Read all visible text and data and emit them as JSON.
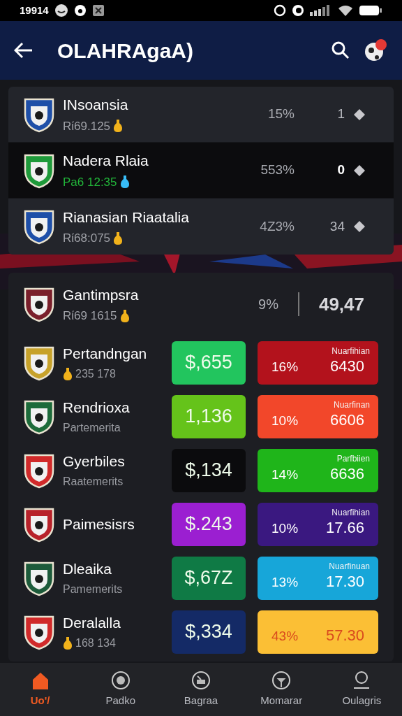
{
  "status_bar": {
    "time": "19914"
  },
  "header": {
    "title": "OLAHRAgaA)"
  },
  "top_list": [
    {
      "name": "INsoansia",
      "subtitle": "Rί69.125",
      "percent": "15%",
      "count": "1",
      "selected": false
    },
    {
      "name": "Nadera Rlaia",
      "subtitle": "Pa6 12:35",
      "percent": "553%",
      "count": "0",
      "selected": true
    },
    {
      "name": "Rianasian Riaatalia",
      "subtitle": "Rί68:075",
      "percent": "4Z3%",
      "count": "34",
      "selected": false
    }
  ],
  "featured": {
    "name": "Gantimpsra",
    "subtitle": "Rί69 1615",
    "percent": "9%",
    "value": "49,47"
  },
  "markets": [
    {
      "name": "Pertandngan",
      "subtitle": "235 178",
      "amount": {
        "text": "$,655",
        "color": "#22c55e"
      },
      "odds": {
        "label": "Nuarfihian",
        "percent": "16%",
        "value": "6430",
        "color": "#b3121c"
      }
    },
    {
      "name": "Rendrioxa",
      "subtitle": "Partemerita",
      "amount": {
        "text": "1,136",
        "color": "#65c31a"
      },
      "odds": {
        "label": "Nuarfinan",
        "percent": "10%",
        "value": "6606",
        "color": "#f2472a"
      }
    },
    {
      "name": "Gyerbiles",
      "subtitle": "Raatemerits",
      "amount": {
        "text": "$,134",
        "color": "#0b0b0d"
      },
      "odds": {
        "label": "Parfbiien",
        "percent": "14%",
        "value": "6636",
        "color": "#1fb51a"
      }
    },
    {
      "name": "Paimesisrs",
      "amount": {
        "text": "$.243",
        "color": "#9b1fd1"
      },
      "odds": {
        "label": "Nuarfihian",
        "percent": "10%",
        "value": "17.66",
        "color": "#3a1880"
      }
    },
    {
      "name": "Dleaika",
      "subtitle": "Pamemerits",
      "amount": {
        "text": "$,67Z",
        "color": "#0f7a45"
      },
      "odds": {
        "label": "Nuarfinuan",
        "percent": "13%",
        "value": "17.30",
        "color": "#17a6d9"
      }
    },
    {
      "name": "Deralalla",
      "subtitle": "168 134",
      "amount": {
        "text": "$,334",
        "color": "#142a66"
      },
      "odds": {
        "percent": "43%",
        "value": "57.30",
        "color": "#fbbf35"
      }
    }
  ],
  "bottom_nav": [
    {
      "label": "Uo'/",
      "selected": true
    },
    {
      "label": "Padko",
      "selected": false
    },
    {
      "label": "Bagraa",
      "selected": false
    },
    {
      "label": "Momarar",
      "selected": false
    },
    {
      "label": "Oulagris",
      "selected": false
    }
  ]
}
